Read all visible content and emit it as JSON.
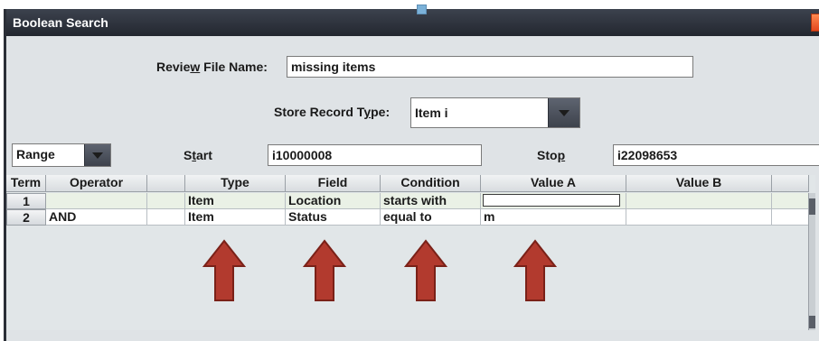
{
  "window": {
    "title": "Boolean Search"
  },
  "review_file": {
    "label_pre": "Revie",
    "label_accel": "w",
    "label_post": " File Name:",
    "value": "missing items"
  },
  "store_record": {
    "label_pre": "Store Record T",
    "label_accel": "y",
    "label_post": "pe:",
    "value": "Item  i"
  },
  "range": {
    "mode": "Range",
    "start_label_pre": "S",
    "start_label_accel": "t",
    "start_label_post": "art",
    "start_value": "i10000008",
    "stop_label_pre": "Sto",
    "stop_label_accel": "p",
    "stop_label_post": "",
    "stop_value": "i22098653"
  },
  "table": {
    "columns": [
      "Term",
      "Operator",
      "",
      "Type",
      "Field",
      "Condition",
      "Value A",
      "Value B",
      ""
    ],
    "rows": [
      {
        "term": "1",
        "operator": "",
        "type": "Item",
        "field": "Location",
        "condition": "starts with",
        "value_a": "",
        "value_b": ""
      },
      {
        "term": "2",
        "operator": "AND",
        "type": "Item",
        "field": "Status",
        "condition": "equal to",
        "value_a": "m",
        "value_b": ""
      }
    ]
  },
  "annotations": {
    "arrow_color": "#b23a2e",
    "arrow_count": 4
  },
  "colors": {
    "titlebar": "#2b3039",
    "panel": "#dfe3e6",
    "selected_row": "#eaf1e6"
  }
}
